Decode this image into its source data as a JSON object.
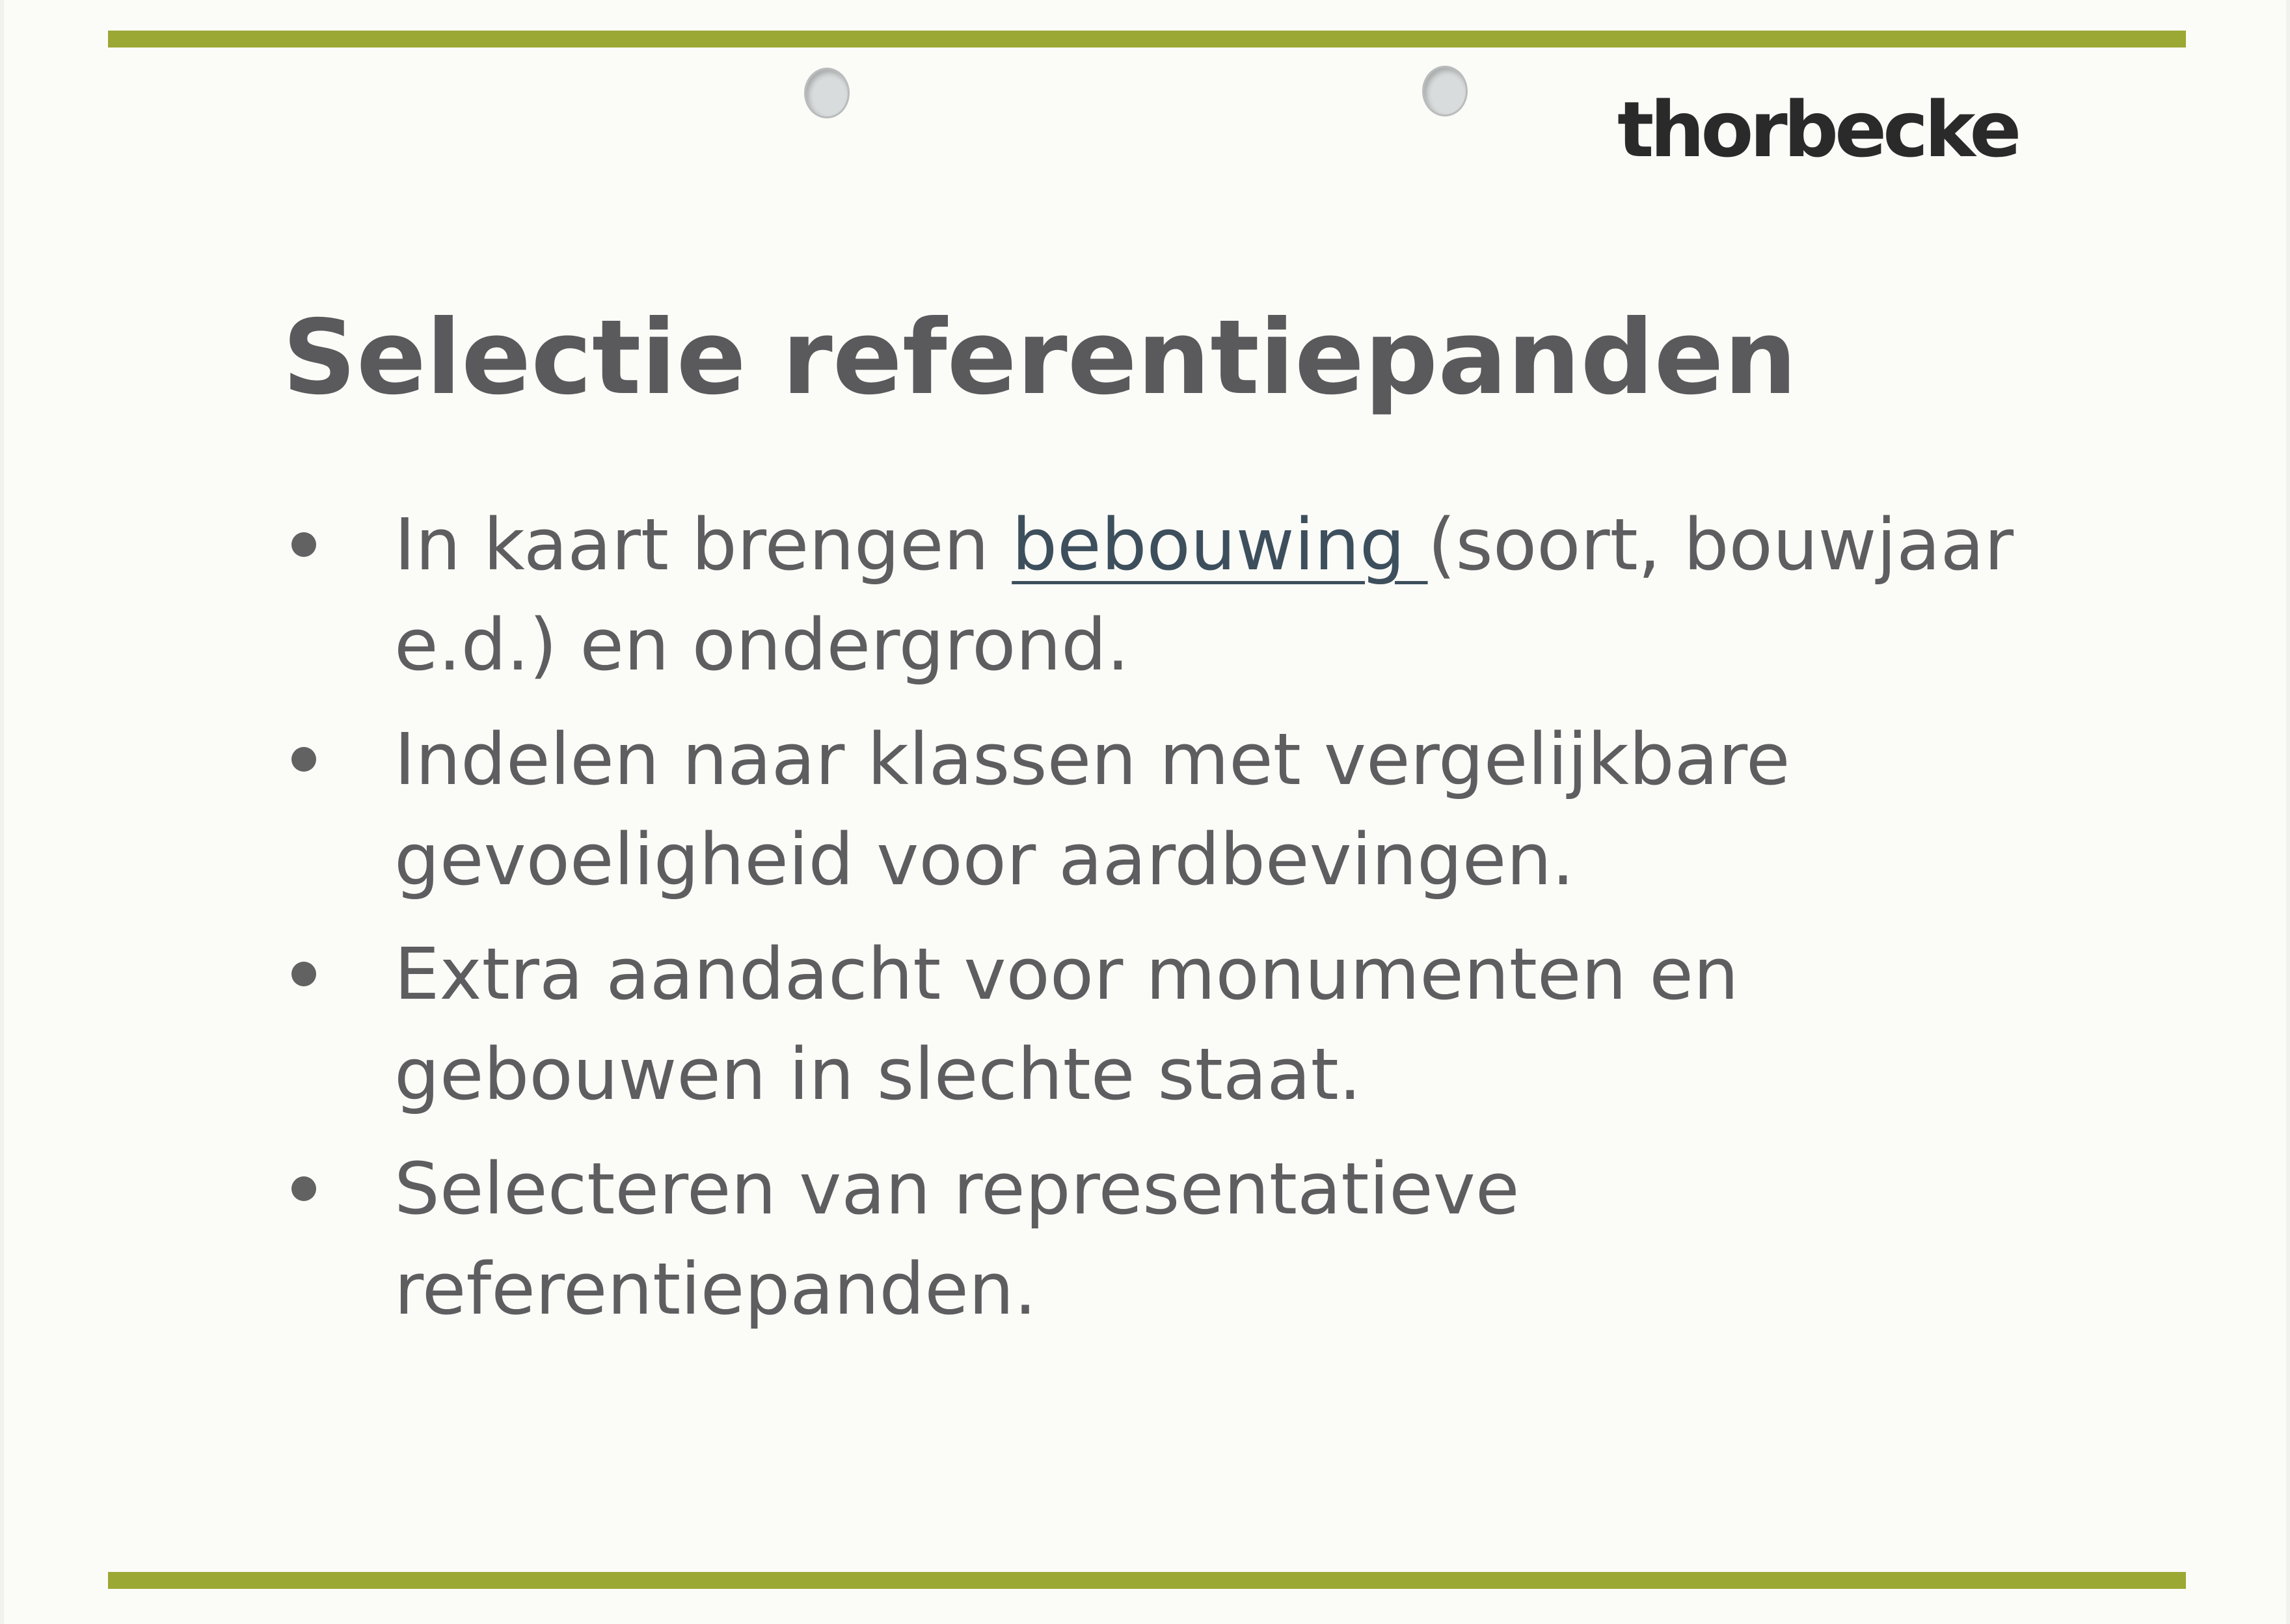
{
  "logo": {
    "text": "thorbecke"
  },
  "slide": {
    "title": "Selectie referentiepanden",
    "bullets": [
      {
        "before": "In kaart brengen ",
        "link": "bebouwing ",
        "after": "(soort, bouwjaar e.d.) en ondergrond."
      },
      {
        "before": "Indelen naar klassen met vergelijkbare gevoeligheid voor aardbevingen."
      },
      {
        "before": "Extra aandacht voor monumenten en gebouwen in slechte staat."
      },
      {
        "before": "Selecteren van representatieve referentiepanden."
      }
    ]
  },
  "colors": {
    "accent_rule": "#9ca834",
    "title_text": "#5a5a5c",
    "body_text": "#5e5e60",
    "link_text": "#3d4f5c",
    "logo_text": "#2a2a2a"
  }
}
